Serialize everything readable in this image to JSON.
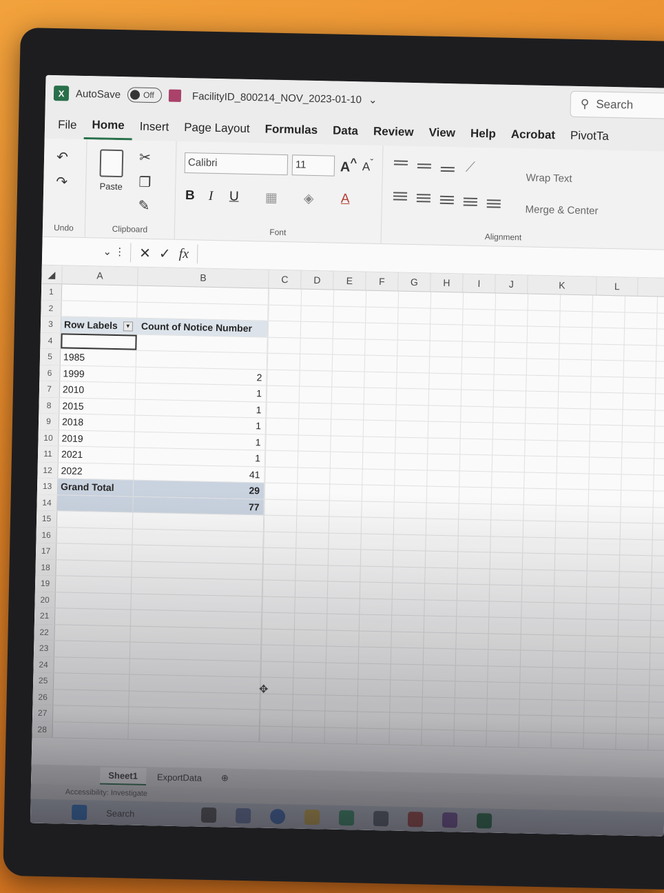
{
  "titlebar": {
    "autosave_label": "AutoSave",
    "autosave_state": "Off",
    "filename": "FacilityID_800214_NOV_2023-01-10",
    "search_placeholder": "Search"
  },
  "tabs": [
    "File",
    "Home",
    "Insert",
    "Page Layout",
    "Formulas",
    "Data",
    "Review",
    "View",
    "Help",
    "Acrobat",
    "PivotTa"
  ],
  "ribbon": {
    "undo_group": "Undo",
    "paste_label": "Paste",
    "clipboard_group": "Clipboard",
    "font_name": "Calibri",
    "font_size": "11",
    "font_group": "Font",
    "bold": "B",
    "italic": "I",
    "underline": "U",
    "wrap_text": "Wrap Text",
    "merge_center": "Merge & Center",
    "alignment_group": "Alignment"
  },
  "formula_bar": {
    "fx": "fx",
    "value": ""
  },
  "columns": [
    "A",
    "B",
    "C",
    "D",
    "E",
    "F",
    "G",
    "H",
    "I",
    "J",
    "K",
    "L"
  ],
  "pivot": {
    "row_labels_header": "Row Labels",
    "value_header": "Count of Notice Number",
    "rows": [
      {
        "label": "",
        "value": ""
      },
      {
        "label": "1985",
        "value": ""
      },
      {
        "label": "1999",
        "value": "2"
      },
      {
        "label": "2010",
        "value": "1"
      },
      {
        "label": "2015",
        "value": "1"
      },
      {
        "label": "2018",
        "value": "1"
      },
      {
        "label": "2019",
        "value": "1"
      },
      {
        "label": "2021",
        "value": "1"
      },
      {
        "label": "2022",
        "value": "41"
      },
      {
        "label": "Grand Total",
        "value": "29"
      },
      {
        "label": "",
        "value": "77"
      }
    ]
  },
  "row_numbers": [
    "1",
    "2",
    "3",
    "4",
    "5",
    "6",
    "7",
    "8",
    "9",
    "10",
    "11",
    "12",
    "13",
    "14",
    "15",
    "16",
    "17",
    "18",
    "19",
    "20",
    "21",
    "22",
    "23",
    "24",
    "25",
    "26",
    "27",
    "28"
  ],
  "sheets": [
    "Sheet1",
    "ExportData"
  ],
  "status_text": "Accessibility: Investigate",
  "taskbar": {
    "search": "Search"
  },
  "colors": {
    "excel_green": "#1e7145",
    "pivot_header": "#dfe7f1",
    "pivot_total": "#cbd6e4"
  }
}
